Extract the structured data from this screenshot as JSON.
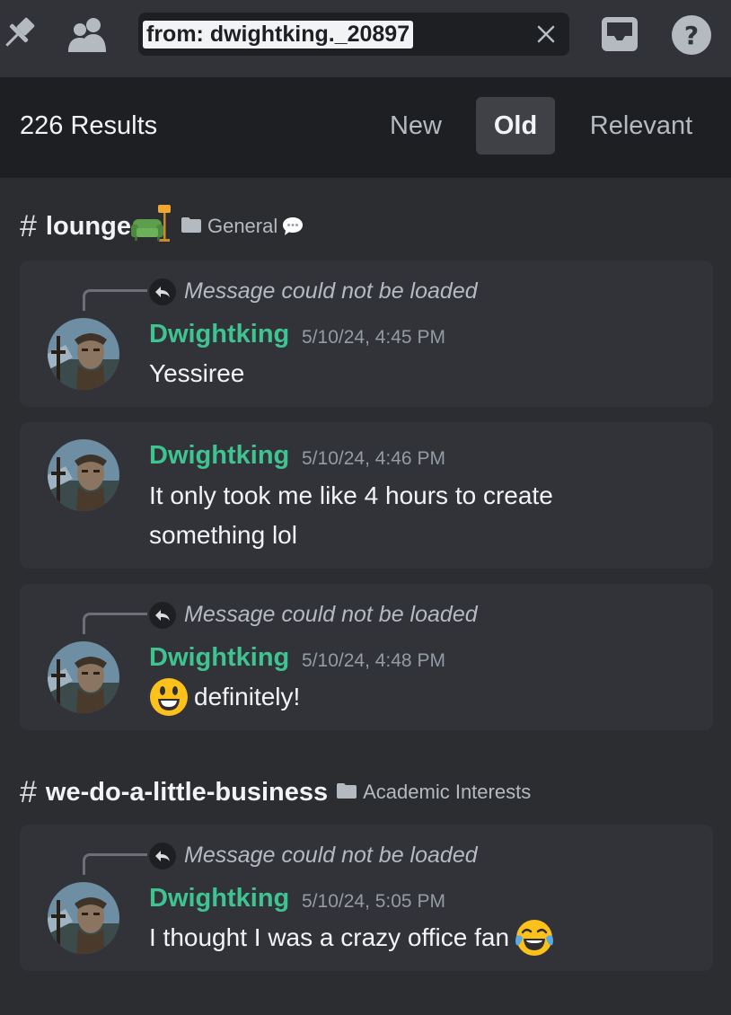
{
  "topbar": {
    "icons": [
      "pin-icon",
      "members-icon",
      "inbox-icon",
      "help-icon"
    ],
    "search_query": "from: dwightking._20897"
  },
  "results": {
    "count_label": "226 Results",
    "sort_tabs": [
      {
        "label": "New",
        "selected": false
      },
      {
        "label": "Old",
        "selected": true
      },
      {
        "label": "Relevant",
        "selected": false
      }
    ]
  },
  "groups": [
    {
      "hash": "#",
      "channel": "lounge",
      "channel_emoji": "couch-and-lamp",
      "category": "General",
      "category_emoji": "speech-balloon",
      "messages": [
        {
          "reply_note": "Message could not be loaded",
          "author": "Dwightking",
          "timestamp": "5/10/24, 4:45 PM",
          "lines": [
            "Yessiree"
          ]
        },
        {
          "author": "Dwightking",
          "timestamp": "5/10/24, 4:46 PM",
          "lines": [
            "It only took me like 4 hours to create",
            "something lol"
          ]
        },
        {
          "reply_note": "Message could not be loaded",
          "author": "Dwightking",
          "timestamp": "5/10/24, 4:48 PM",
          "lines": [
            "definitely!"
          ],
          "leading_emoji": "smiley"
        }
      ]
    },
    {
      "hash": "#",
      "channel": "we-do-a-little-business",
      "category": "Academic Interests",
      "messages": [
        {
          "reply_note": "Message could not be loaded",
          "author": "Dwightking",
          "timestamp": "5/10/24, 5:05 PM",
          "lines": [
            "I thought I was a crazy office fan"
          ],
          "trailing_emoji": "joy"
        }
      ]
    }
  ],
  "colors": {
    "author": "#3fc391",
    "background": "#2b2d31",
    "card": "#313338",
    "header": "#1e1f22"
  }
}
